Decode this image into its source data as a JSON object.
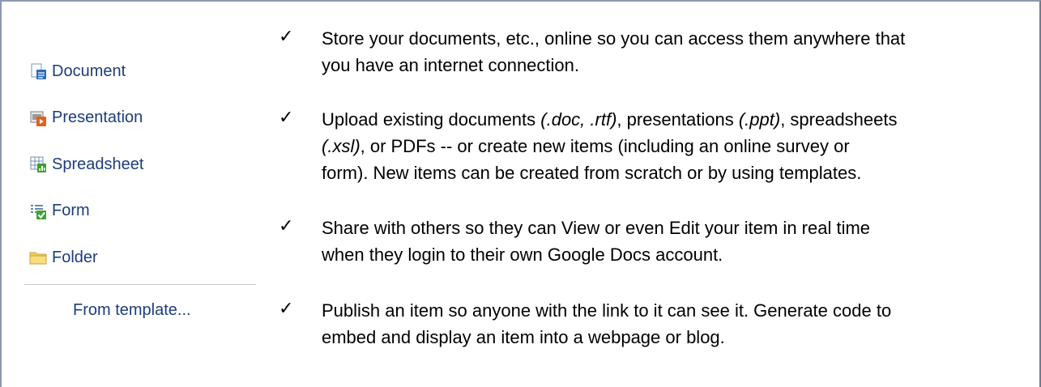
{
  "menu": {
    "items": [
      {
        "label": "Document",
        "icon": "document-icon"
      },
      {
        "label": "Presentation",
        "icon": "presentation-icon"
      },
      {
        "label": "Spreadsheet",
        "icon": "spreadsheet-icon"
      },
      {
        "label": "Form",
        "icon": "form-icon"
      },
      {
        "label": "Folder",
        "icon": "folder-icon"
      }
    ],
    "template_label": "From template..."
  },
  "checkmark": "✓",
  "bullets": [
    {
      "lines": [
        "Store your documents, etc., online so you can access them anywhere that",
        "you have an internet connection."
      ]
    },
    {
      "lines": [
        "Upload existing documents ",
        "(.doc, .rtf)",
        ",  presentations ",
        "(.ppt)",
        ",  spreadsheets",
        "(.xsl)",
        ",  or PDFs  -- or create new items  (including an online survey or",
        "form).  New items can be created from scratch or by using templates."
      ]
    },
    {
      "lines": [
        "Share with others so they can View or even Edit your item in real time",
        "when they login to their own Google Docs account."
      ]
    },
    {
      "lines": [
        "Publish an item so anyone with the link to it can see it.  Generate code to",
        "embed and display an item into a webpage or blog."
      ]
    }
  ]
}
